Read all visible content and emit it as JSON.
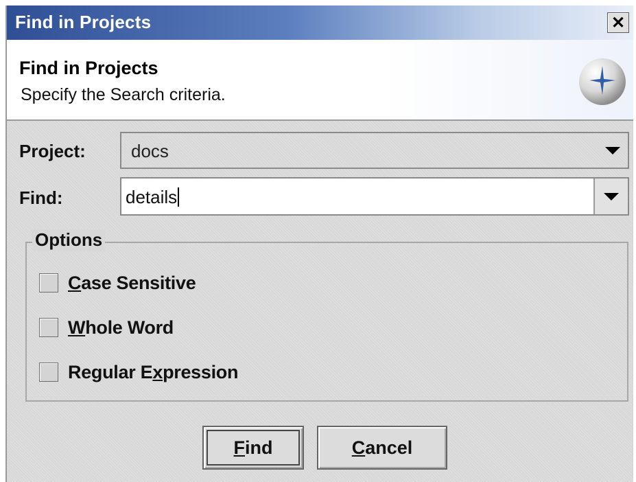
{
  "window": {
    "title": "Find in Projects",
    "close_glyph": "✕"
  },
  "header": {
    "title": "Find in Projects",
    "subtitle": "Specify the Search criteria.",
    "icon": "netbeans-logo-icon"
  },
  "form": {
    "project_label": "Project:",
    "project_value": "docs",
    "find_label": "Find:",
    "find_value": "details"
  },
  "options": {
    "legend": "Options",
    "items": [
      {
        "label_mnemonic": "C",
        "label_rest": "ase Sensitive",
        "checked": false
      },
      {
        "label_mnemonic": "W",
        "label_rest": "hole Word",
        "checked": false
      },
      {
        "label_pre": "Regular E",
        "label_mnemonic": "x",
        "label_rest": "pression",
        "checked": false
      }
    ]
  },
  "buttons": {
    "find": {
      "mnemonic": "F",
      "rest": "ind"
    },
    "cancel": {
      "mnemonic": "C",
      "rest": "ancel"
    }
  },
  "colors": {
    "titlebar_start": "#2f4f95",
    "titlebar_end": "#e9eff8",
    "dialog_bg": "#d8d8d8"
  }
}
